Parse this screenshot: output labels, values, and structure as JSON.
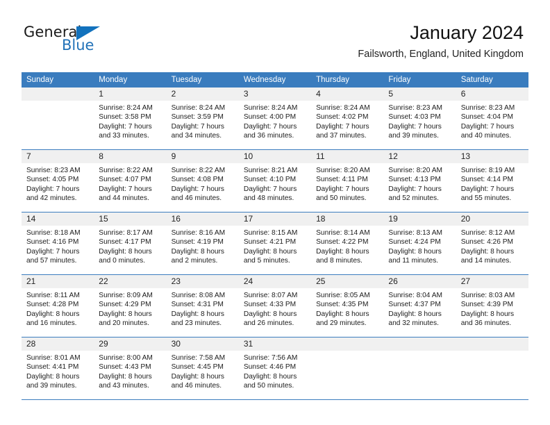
{
  "brand": {
    "name_part1": "General",
    "name_part2": "Blue",
    "triangle_color": "#1272bd",
    "blue_text_color": "#2272b8"
  },
  "header": {
    "title": "January 2024",
    "subtitle": "Failsworth, England, United Kingdom"
  },
  "theme": {
    "header_row_bg": "#3a7cbe",
    "daynum_bg": "#f0f0f0",
    "cell_bg": "#ffffff",
    "text_color": "#1c1c1c"
  },
  "weekday_headers": [
    "Sunday",
    "Monday",
    "Tuesday",
    "Wednesday",
    "Thursday",
    "Friday",
    "Saturday"
  ],
  "labels": {
    "sunrise_prefix": "Sunrise:",
    "sunset_prefix": "Sunset:",
    "daylight_prefix": "Daylight:"
  },
  "weeks": [
    [
      {
        "day": "",
        "empty": true,
        "line1": "",
        "line2": "",
        "line3": "",
        "line4": ""
      },
      {
        "day": "1",
        "empty": false,
        "line1": "Sunrise: 8:24 AM",
        "line2": "Sunset: 3:58 PM",
        "line3": "Daylight: 7 hours",
        "line4": "and 33 minutes."
      },
      {
        "day": "2",
        "empty": false,
        "line1": "Sunrise: 8:24 AM",
        "line2": "Sunset: 3:59 PM",
        "line3": "Daylight: 7 hours",
        "line4": "and 34 minutes."
      },
      {
        "day": "3",
        "empty": false,
        "line1": "Sunrise: 8:24 AM",
        "line2": "Sunset: 4:00 PM",
        "line3": "Daylight: 7 hours",
        "line4": "and 36 minutes."
      },
      {
        "day": "4",
        "empty": false,
        "line1": "Sunrise: 8:24 AM",
        "line2": "Sunset: 4:02 PM",
        "line3": "Daylight: 7 hours",
        "line4": "and 37 minutes."
      },
      {
        "day": "5",
        "empty": false,
        "line1": "Sunrise: 8:23 AM",
        "line2": "Sunset: 4:03 PM",
        "line3": "Daylight: 7 hours",
        "line4": "and 39 minutes."
      },
      {
        "day": "6",
        "empty": false,
        "line1": "Sunrise: 8:23 AM",
        "line2": "Sunset: 4:04 PM",
        "line3": "Daylight: 7 hours",
        "line4": "and 40 minutes."
      }
    ],
    [
      {
        "day": "7",
        "empty": false,
        "line1": "Sunrise: 8:23 AM",
        "line2": "Sunset: 4:05 PM",
        "line3": "Daylight: 7 hours",
        "line4": "and 42 minutes."
      },
      {
        "day": "8",
        "empty": false,
        "line1": "Sunrise: 8:22 AM",
        "line2": "Sunset: 4:07 PM",
        "line3": "Daylight: 7 hours",
        "line4": "and 44 minutes."
      },
      {
        "day": "9",
        "empty": false,
        "line1": "Sunrise: 8:22 AM",
        "line2": "Sunset: 4:08 PM",
        "line3": "Daylight: 7 hours",
        "line4": "and 46 minutes."
      },
      {
        "day": "10",
        "empty": false,
        "line1": "Sunrise: 8:21 AM",
        "line2": "Sunset: 4:10 PM",
        "line3": "Daylight: 7 hours",
        "line4": "and 48 minutes."
      },
      {
        "day": "11",
        "empty": false,
        "line1": "Sunrise: 8:20 AM",
        "line2": "Sunset: 4:11 PM",
        "line3": "Daylight: 7 hours",
        "line4": "and 50 minutes."
      },
      {
        "day": "12",
        "empty": false,
        "line1": "Sunrise: 8:20 AM",
        "line2": "Sunset: 4:13 PM",
        "line3": "Daylight: 7 hours",
        "line4": "and 52 minutes."
      },
      {
        "day": "13",
        "empty": false,
        "line1": "Sunrise: 8:19 AM",
        "line2": "Sunset: 4:14 PM",
        "line3": "Daylight: 7 hours",
        "line4": "and 55 minutes."
      }
    ],
    [
      {
        "day": "14",
        "empty": false,
        "line1": "Sunrise: 8:18 AM",
        "line2": "Sunset: 4:16 PM",
        "line3": "Daylight: 7 hours",
        "line4": "and 57 minutes."
      },
      {
        "day": "15",
        "empty": false,
        "line1": "Sunrise: 8:17 AM",
        "line2": "Sunset: 4:17 PM",
        "line3": "Daylight: 8 hours",
        "line4": "and 0 minutes."
      },
      {
        "day": "16",
        "empty": false,
        "line1": "Sunrise: 8:16 AM",
        "line2": "Sunset: 4:19 PM",
        "line3": "Daylight: 8 hours",
        "line4": "and 2 minutes."
      },
      {
        "day": "17",
        "empty": false,
        "line1": "Sunrise: 8:15 AM",
        "line2": "Sunset: 4:21 PM",
        "line3": "Daylight: 8 hours",
        "line4": "and 5 minutes."
      },
      {
        "day": "18",
        "empty": false,
        "line1": "Sunrise: 8:14 AM",
        "line2": "Sunset: 4:22 PM",
        "line3": "Daylight: 8 hours",
        "line4": "and 8 minutes."
      },
      {
        "day": "19",
        "empty": false,
        "line1": "Sunrise: 8:13 AM",
        "line2": "Sunset: 4:24 PM",
        "line3": "Daylight: 8 hours",
        "line4": "and 11 minutes."
      },
      {
        "day": "20",
        "empty": false,
        "line1": "Sunrise: 8:12 AM",
        "line2": "Sunset: 4:26 PM",
        "line3": "Daylight: 8 hours",
        "line4": "and 14 minutes."
      }
    ],
    [
      {
        "day": "21",
        "empty": false,
        "line1": "Sunrise: 8:11 AM",
        "line2": "Sunset: 4:28 PM",
        "line3": "Daylight: 8 hours",
        "line4": "and 16 minutes."
      },
      {
        "day": "22",
        "empty": false,
        "line1": "Sunrise: 8:09 AM",
        "line2": "Sunset: 4:29 PM",
        "line3": "Daylight: 8 hours",
        "line4": "and 20 minutes."
      },
      {
        "day": "23",
        "empty": false,
        "line1": "Sunrise: 8:08 AM",
        "line2": "Sunset: 4:31 PM",
        "line3": "Daylight: 8 hours",
        "line4": "and 23 minutes."
      },
      {
        "day": "24",
        "empty": false,
        "line1": "Sunrise: 8:07 AM",
        "line2": "Sunset: 4:33 PM",
        "line3": "Daylight: 8 hours",
        "line4": "and 26 minutes."
      },
      {
        "day": "25",
        "empty": false,
        "line1": "Sunrise: 8:05 AM",
        "line2": "Sunset: 4:35 PM",
        "line3": "Daylight: 8 hours",
        "line4": "and 29 minutes."
      },
      {
        "day": "26",
        "empty": false,
        "line1": "Sunrise: 8:04 AM",
        "line2": "Sunset: 4:37 PM",
        "line3": "Daylight: 8 hours",
        "line4": "and 32 minutes."
      },
      {
        "day": "27",
        "empty": false,
        "line1": "Sunrise: 8:03 AM",
        "line2": "Sunset: 4:39 PM",
        "line3": "Daylight: 8 hours",
        "line4": "and 36 minutes."
      }
    ],
    [
      {
        "day": "28",
        "empty": false,
        "line1": "Sunrise: 8:01 AM",
        "line2": "Sunset: 4:41 PM",
        "line3": "Daylight: 8 hours",
        "line4": "and 39 minutes."
      },
      {
        "day": "29",
        "empty": false,
        "line1": "Sunrise: 8:00 AM",
        "line2": "Sunset: 4:43 PM",
        "line3": "Daylight: 8 hours",
        "line4": "and 43 minutes."
      },
      {
        "day": "30",
        "empty": false,
        "line1": "Sunrise: 7:58 AM",
        "line2": "Sunset: 4:45 PM",
        "line3": "Daylight: 8 hours",
        "line4": "and 46 minutes."
      },
      {
        "day": "31",
        "empty": false,
        "line1": "Sunrise: 7:56 AM",
        "line2": "Sunset: 4:46 PM",
        "line3": "Daylight: 8 hours",
        "line4": "and 50 minutes."
      },
      {
        "day": "",
        "empty": true,
        "line1": "",
        "line2": "",
        "line3": "",
        "line4": ""
      },
      {
        "day": "",
        "empty": true,
        "line1": "",
        "line2": "",
        "line3": "",
        "line4": ""
      },
      {
        "day": "",
        "empty": true,
        "line1": "",
        "line2": "",
        "line3": "",
        "line4": ""
      }
    ]
  ]
}
